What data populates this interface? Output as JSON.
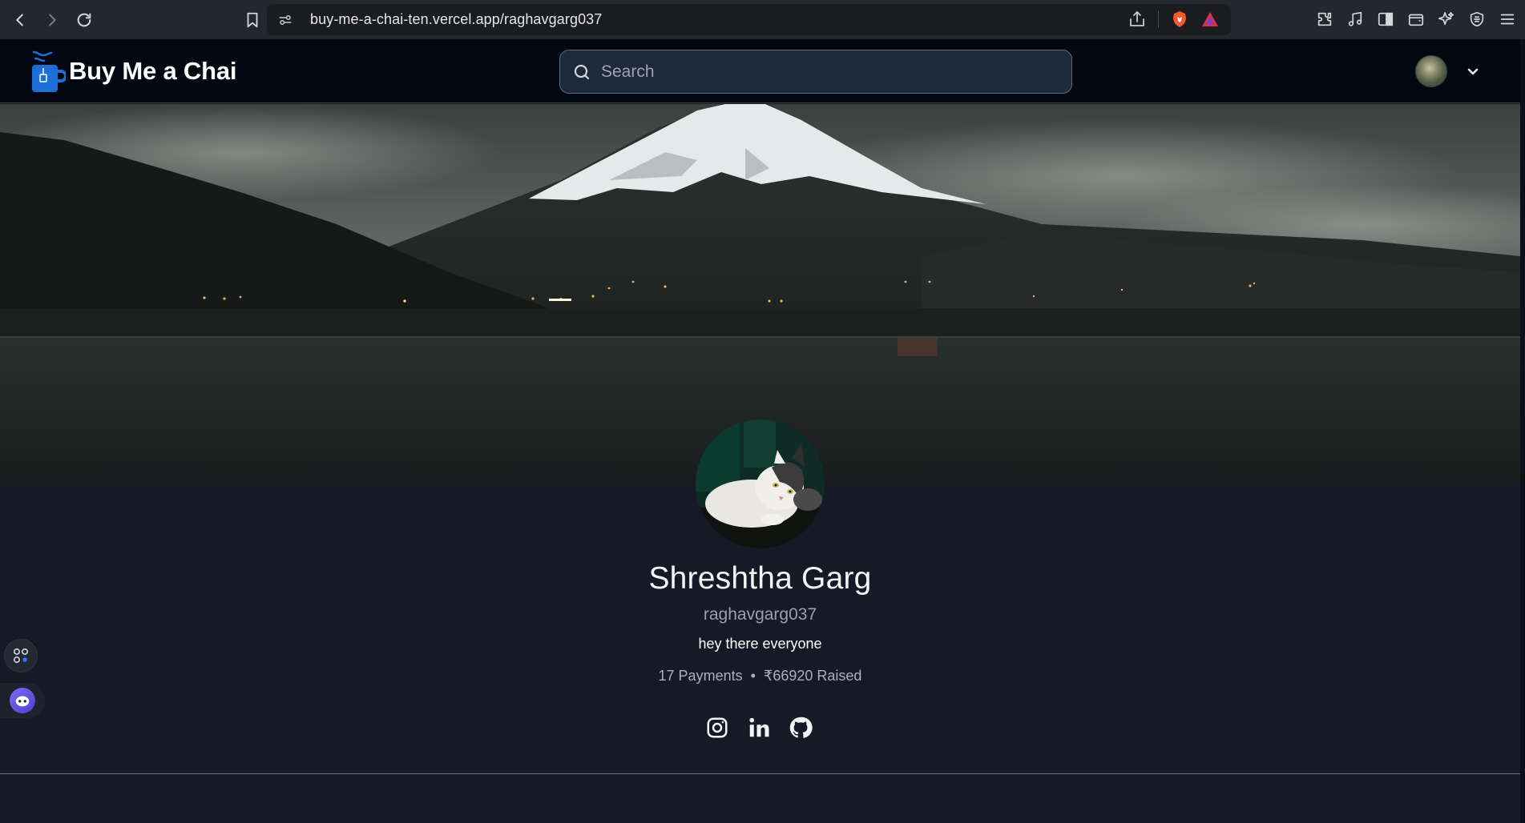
{
  "browser": {
    "url": "buy-me-a-chai-ten.vercel.app/raghavgarg037"
  },
  "navbar": {
    "brand_name": "Buy Me a Chai",
    "search_placeholder": "Search",
    "accent_color": "#1d6fd8"
  },
  "profile": {
    "name": "Shreshtha Garg",
    "username": "raghavgarg037",
    "bio": "hey there everyone",
    "payments": "17 Payments",
    "separator": "•",
    "raised": "₹66920 Raised"
  },
  "socials": [
    {
      "icon": "instagram-icon"
    },
    {
      "icon": "linkedin-icon"
    },
    {
      "icon": "github-icon"
    }
  ],
  "colors": {
    "page_bg": "#161a27",
    "navbar_bg": "#030712",
    "search_bg": "#1e293b"
  }
}
